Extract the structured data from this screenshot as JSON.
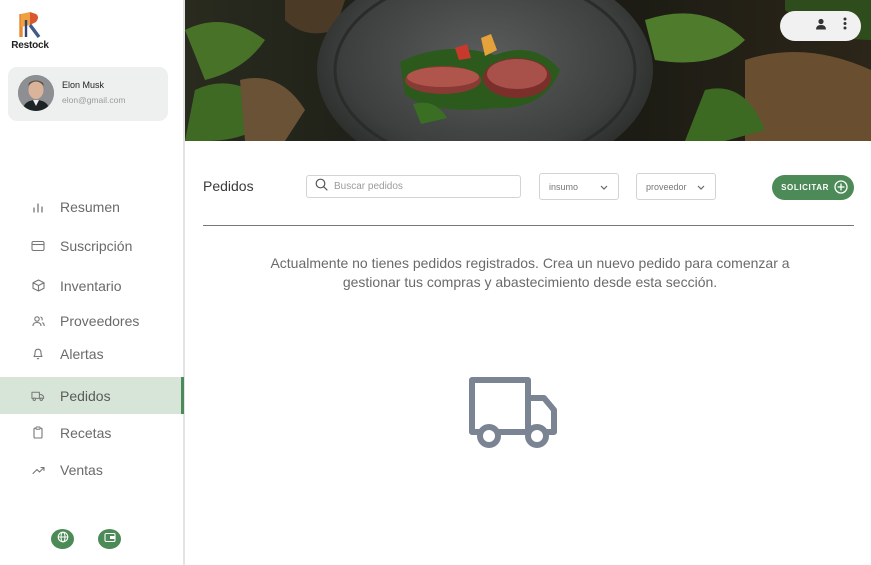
{
  "app": {
    "logo_text": "Restock"
  },
  "user": {
    "name": "Elon Musk",
    "email": "elon@gmail.com"
  },
  "sidebar": {
    "items": [
      {
        "label": "Resumen",
        "icon": "bar-chart-icon",
        "active": false
      },
      {
        "label": "Suscripción",
        "icon": "credit-card-icon",
        "active": false
      },
      {
        "label": "Inventario",
        "icon": "box-icon",
        "active": false
      },
      {
        "label": "Proveedores",
        "icon": "users-icon",
        "active": false
      },
      {
        "label": "Alertas",
        "icon": "bell-icon",
        "active": false
      },
      {
        "label": "Pedidos",
        "icon": "truck-icon",
        "active": true
      },
      {
        "label": "Recetas",
        "icon": "clipboard-icon",
        "active": false
      },
      {
        "label": "Ventas",
        "icon": "trending-up-icon",
        "active": false
      }
    ],
    "footer": [
      {
        "icon": "globe-icon"
      },
      {
        "icon": "wallet-icon"
      }
    ]
  },
  "header": {
    "hero_image": "food-plate-banner",
    "user_menu_icons": [
      "user-icon",
      "more-vertical-icon"
    ]
  },
  "main": {
    "title": "Pedidos",
    "search": {
      "placeholder": "Buscar pedidos",
      "value": ""
    },
    "filters": [
      {
        "value": "insumo"
      },
      {
        "value": "proveedor"
      }
    ],
    "solicitar_label": "SOLICITAR",
    "empty_message": "Actualmente no tienes pedidos registrados. Crea un nuevo pedido para comenzar a gestionar tus compras y abastecimiento desde esta sección.",
    "empty_icon": "truck-icon"
  },
  "colors": {
    "accent": "#4c8a58",
    "active_bg": "#d6e5d7",
    "text": "#6a6a6a"
  }
}
